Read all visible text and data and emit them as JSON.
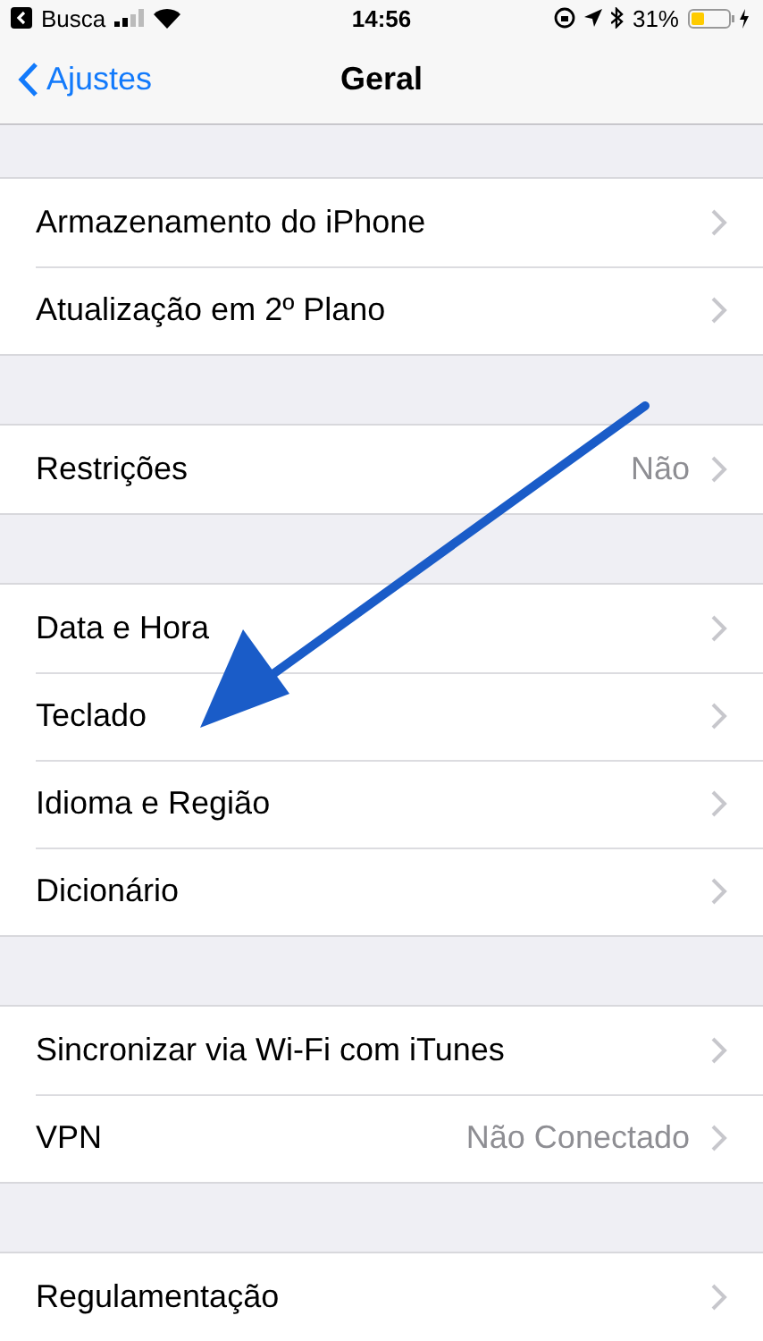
{
  "status_bar": {
    "back_app": "Busca",
    "time": "14:56",
    "battery": "31%"
  },
  "nav": {
    "back": "Ajustes",
    "title": "Geral"
  },
  "sections": [
    {
      "rows": [
        {
          "label": "Armazenamento do iPhone"
        },
        {
          "label": "Atualização em 2º Plano"
        }
      ]
    },
    {
      "rows": [
        {
          "label": "Restrições",
          "value": "Não"
        }
      ]
    },
    {
      "rows": [
        {
          "label": "Data e Hora"
        },
        {
          "label": "Teclado"
        },
        {
          "label": "Idioma e Região"
        },
        {
          "label": "Dicionário"
        }
      ]
    },
    {
      "rows": [
        {
          "label": "Sincronizar via Wi-Fi com iTunes"
        },
        {
          "label": "VPN",
          "value": "Não Conectado"
        }
      ]
    },
    {
      "rows": [
        {
          "label": "Regulamentação"
        }
      ]
    }
  ]
}
